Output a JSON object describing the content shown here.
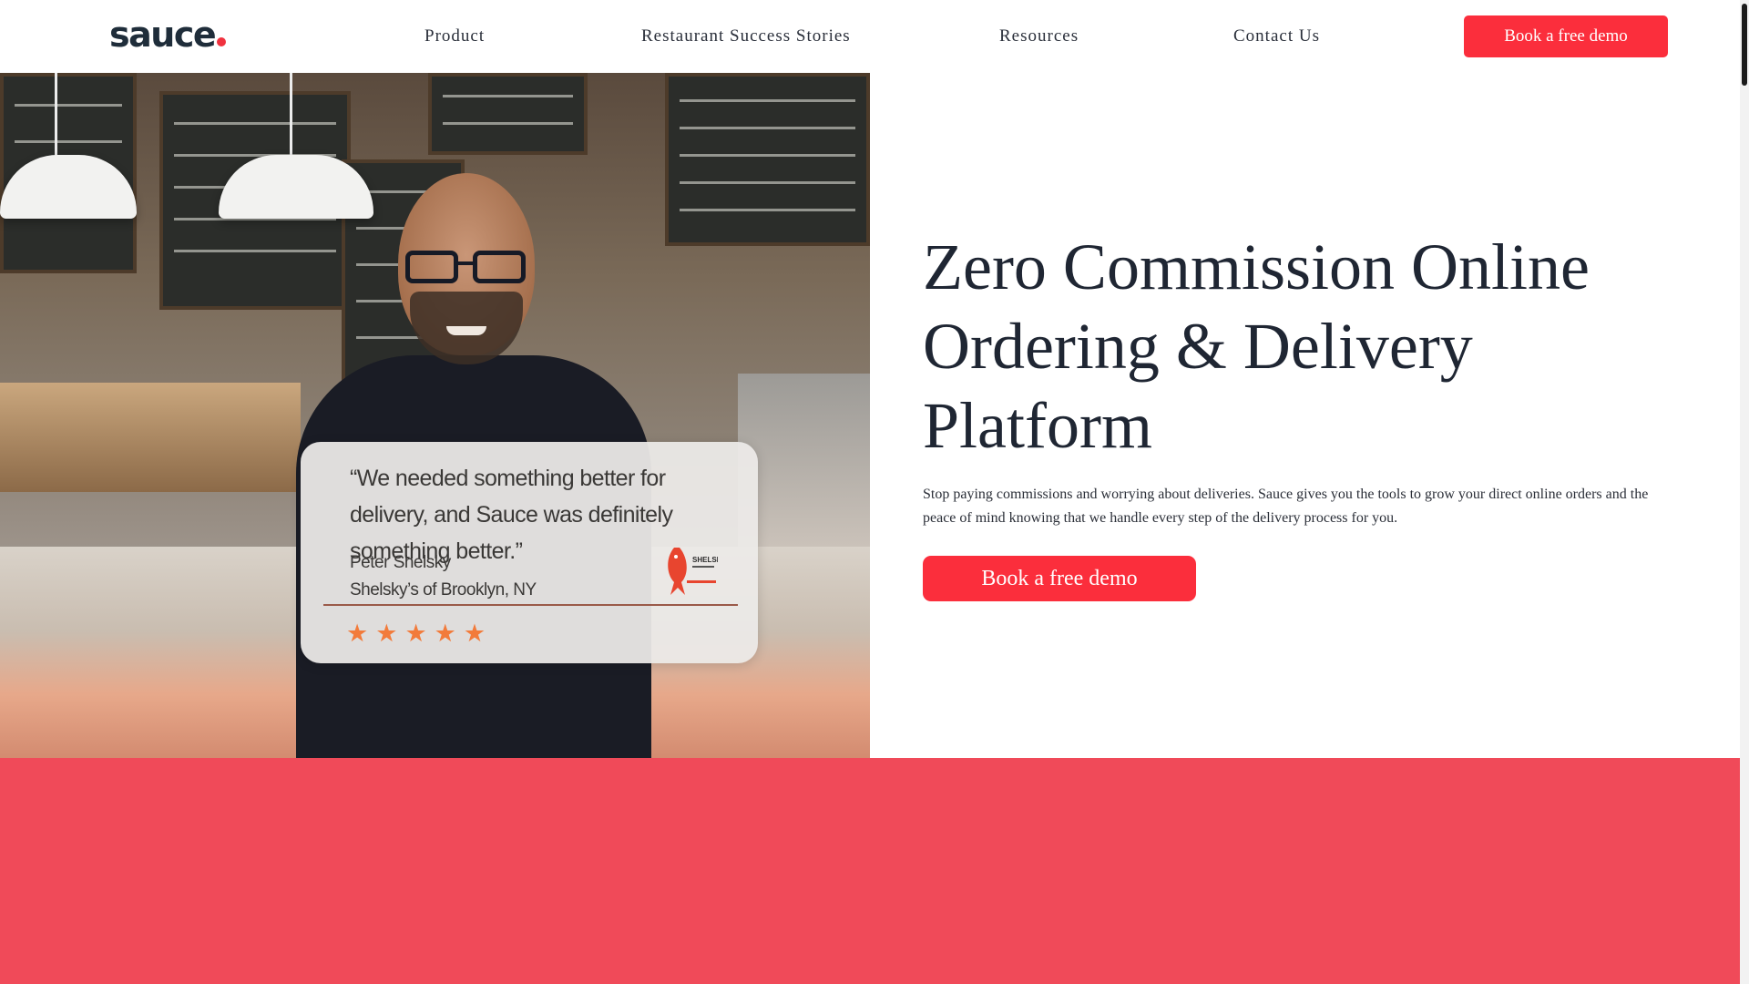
{
  "header": {
    "logo_text": "sauce",
    "nav": [
      {
        "label": "Product"
      },
      {
        "label": "Restaurant Success Stories"
      },
      {
        "label": "Resources"
      },
      {
        "label": "Contact Us"
      }
    ],
    "cta_label": "Book a free demo"
  },
  "hero": {
    "title": "Zero Commission Online Ordering & Delivery Platform",
    "subtitle": "Stop paying commissions and worrying about deliveries. Sauce gives you the tools to grow your direct online orders and the peace of mind knowing that we handle every step of the delivery process for you.",
    "cta_label": "Book a free demo",
    "testimonial": {
      "quote": "“We needed something better for delivery, and Sauce was definitely something better.”",
      "name": "Peter Shelsky",
      "place": "Shelsky’s of Brooklyn, NY",
      "logo_text": "SHELSKY'S",
      "rating": 5
    }
  },
  "colors": {
    "brand_red": "#fb2e3c",
    "band_red": "#f04a59",
    "text_dark": "#1f2633"
  }
}
